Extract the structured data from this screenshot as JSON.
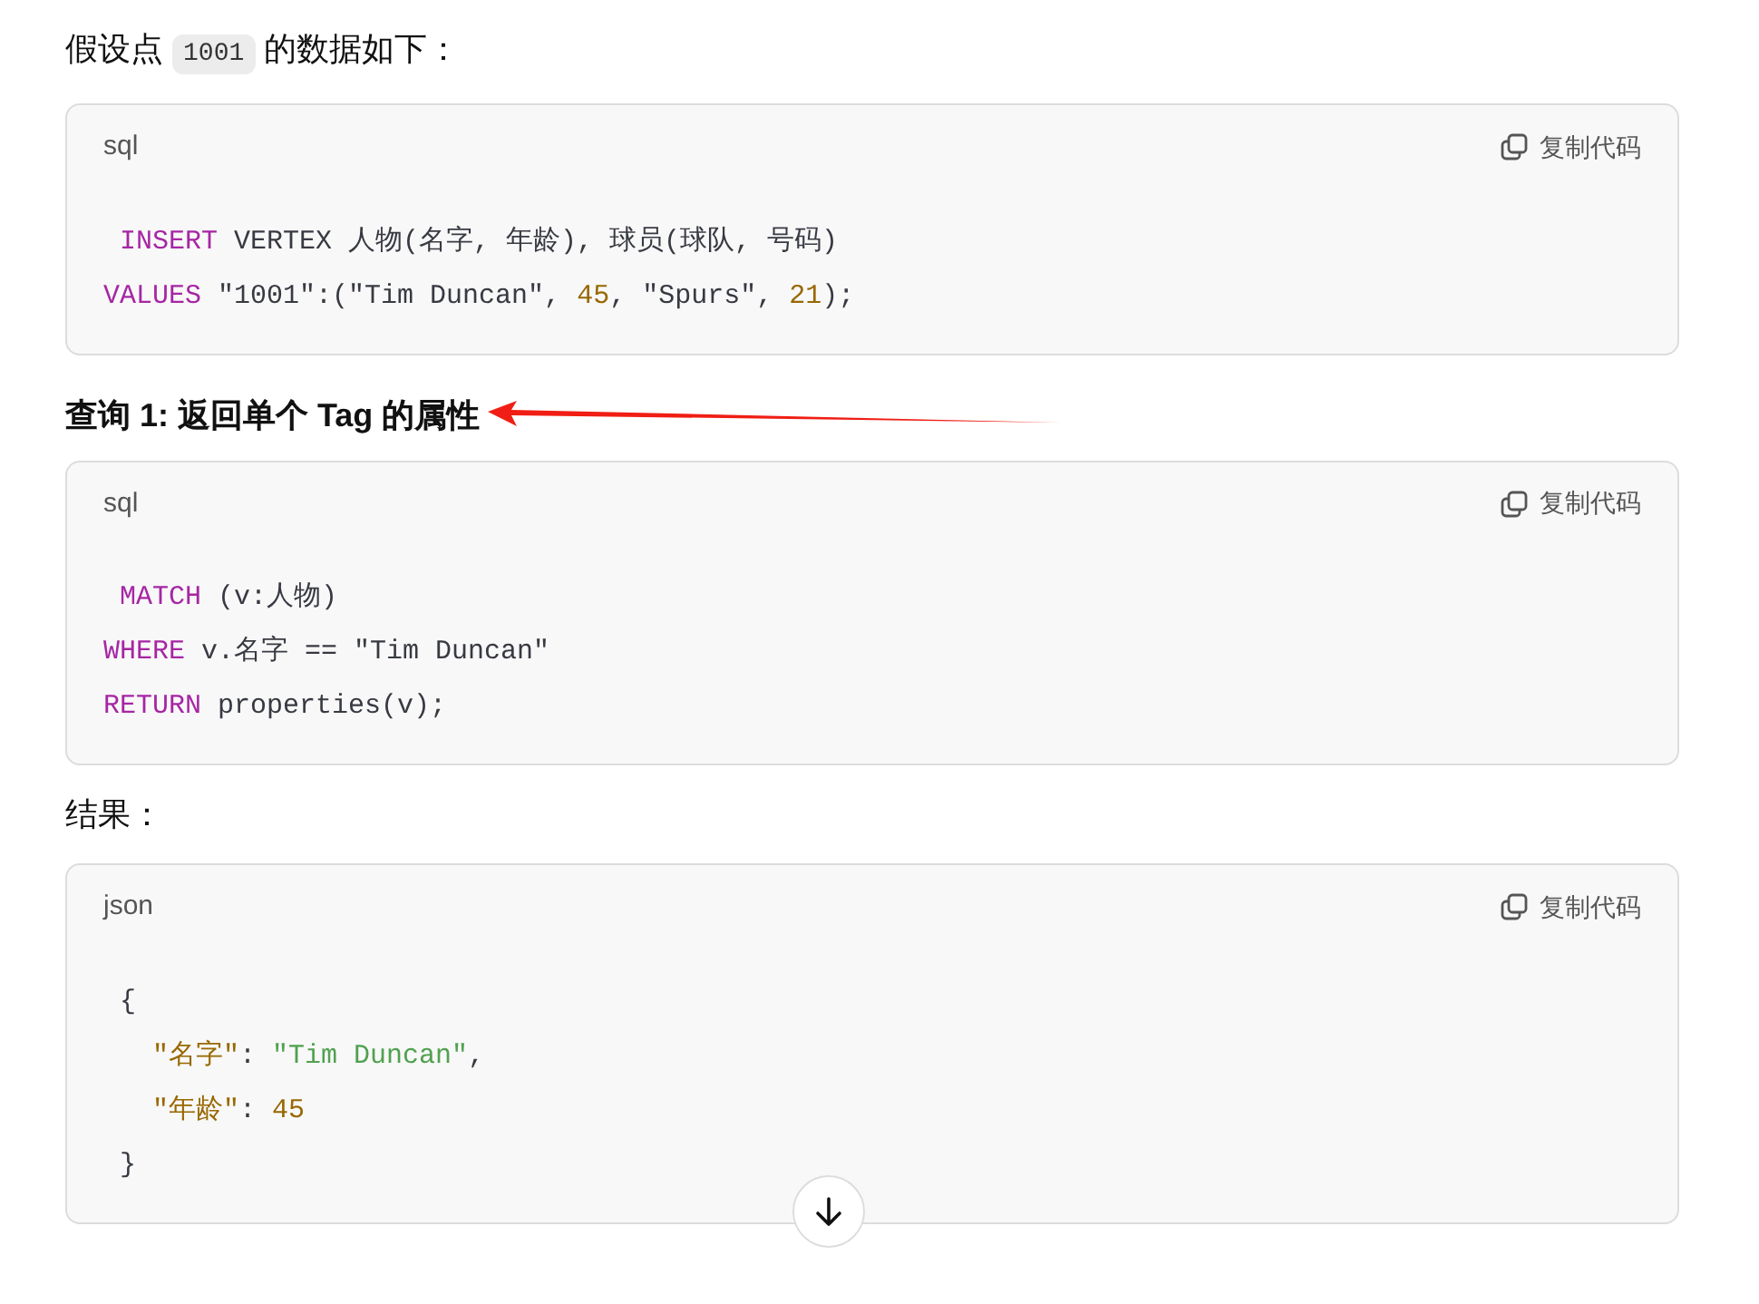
{
  "blocks": [
    {
      "kind": "paragraph",
      "parts": [
        {
          "kind": "text",
          "text": "假设点 "
        },
        {
          "kind": "code",
          "text": "1001"
        },
        {
          "kind": "text",
          "text": " 的数据如下："
        }
      ]
    },
    {
      "kind": "code_block",
      "language": "sql",
      "copy_label": "复制代码",
      "lines": [
        [
          {
            "kind": "keyword",
            "text": " INSERT"
          },
          {
            "kind": "plain",
            "text": " VERTEX 人物(名字, 年龄), 球员(球队, 号码)"
          }
        ],
        [
          {
            "kind": "keyword",
            "text": "VALUES"
          },
          {
            "kind": "plain",
            "text": " \"1001\":(\"Tim Duncan\", "
          },
          {
            "kind": "number",
            "text": "45"
          },
          {
            "kind": "plain",
            "text": ", \"Spurs\", "
          },
          {
            "kind": "number",
            "text": "21"
          },
          {
            "kind": "plain",
            "text": ");"
          }
        ]
      ]
    },
    {
      "kind": "heading",
      "text": "查询 1: 返回单个 Tag 的属性",
      "arrow": true
    },
    {
      "kind": "code_block",
      "language": "sql",
      "copy_label": "复制代码",
      "lines": [
        [
          {
            "kind": "keyword",
            "text": " MATCH"
          },
          {
            "kind": "plain",
            "text": " (v:人物)"
          }
        ],
        [
          {
            "kind": "keyword",
            "text": "WHERE"
          },
          {
            "kind": "plain",
            "text": " v.名字 == \"Tim Duncan\""
          }
        ],
        [
          {
            "kind": "keyword",
            "text": "RETURN"
          },
          {
            "kind": "plain",
            "text": " properties(v);"
          }
        ]
      ]
    },
    {
      "kind": "paragraph",
      "parts": [
        {
          "kind": "text",
          "text": "结果："
        }
      ]
    },
    {
      "kind": "code_block",
      "language": "json",
      "copy_label": "复制代码",
      "lines": [
        [
          {
            "kind": "plain",
            "text": " {"
          }
        ],
        [
          {
            "kind": "key",
            "text": "   \"名字\""
          },
          {
            "kind": "plain",
            "text": ": "
          },
          {
            "kind": "string",
            "text": "\"Tim Duncan\""
          },
          {
            "kind": "plain",
            "text": ","
          }
        ],
        [
          {
            "kind": "key",
            "text": "   \"年龄\""
          },
          {
            "kind": "plain",
            "text": ": "
          },
          {
            "kind": "number",
            "text": "45"
          }
        ],
        [
          {
            "kind": "plain",
            "text": " }"
          }
        ]
      ]
    }
  ]
}
